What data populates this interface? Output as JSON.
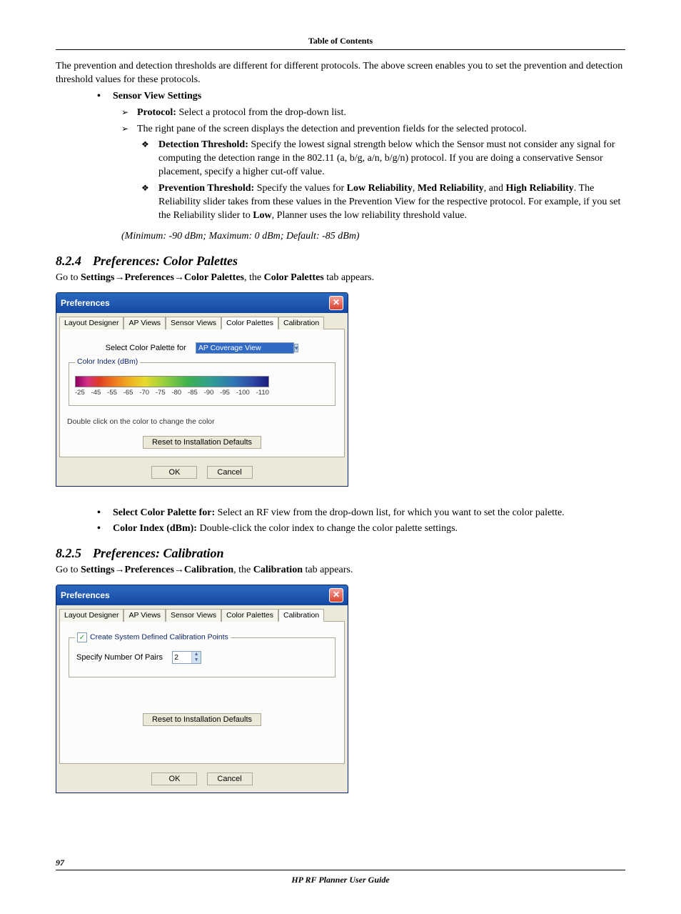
{
  "header": {
    "toc": "Table of Contents"
  },
  "intro": "The prevention and detection thresholds are different for different protocols. The above screen enables you to set the prevention and detection threshold values for these protocols.",
  "sensor_view": {
    "title": "Sensor View Settings",
    "protocol": {
      "label": "Protocol:",
      "text": " Select a protocol from the drop‑down list."
    },
    "right_pane": "The right pane of the screen displays the detection and prevention fields for the selected protocol.",
    "detection": {
      "label": "Detection Threshold:",
      "text": " Specify the lowest signal strength below which the Sensor must not consider any signal for computing the detection range in the 802.11 (a, b/g, a/n, b/g/n) protocol. If you are doing a conservative Sensor placement, specify a higher cut‑off value."
    },
    "prevention": {
      "label": "Prevention Threshold:",
      "pre": " Specify the values for ",
      "low": "Low Reliability",
      "mid": ", ",
      "med": "Med Reliability",
      "mid2": ", and ",
      "high": "High Reliability",
      "post": ". The Reliability slider takes from these values in the Prevention View for the respective protocol. For example, if you set the Reliability slider to ",
      "low2": "Low",
      "post2": ", Planner uses the low reliability threshold value."
    },
    "minmax": "(Minimum: -90 dBm; Maximum: 0 dBm; Default: -85 dBm)"
  },
  "sec824": {
    "num": "8.2.4",
    "title": "Preferences: Color Palettes",
    "goto_pre": "Go to ",
    "path1": "Settings",
    "arrow": "→",
    "path2": "Preferences",
    "path3": "Color Palettes",
    "mid": ", the ",
    "tab": "Color Palettes",
    "post": " tab appears."
  },
  "dlg1": {
    "title": "Preferences",
    "tabs": [
      "Layout Designer",
      "AP Views",
      "Sensor Views",
      "Color Palettes",
      "Calibration"
    ],
    "active_tab": 3,
    "select_label": "Select Color Palette for",
    "select_value": "AP Coverage View",
    "group_title": "Color Index (dBm)",
    "scale": [
      "-25",
      "-45",
      "-55",
      "-65",
      "-70",
      "-75",
      "-80",
      "-85",
      "-90",
      "-95",
      "-100",
      "-110"
    ],
    "hint": "Double click on the color to change the color",
    "reset": "Reset to Installation Defaults",
    "ok": "OK",
    "cancel": "Cancel"
  },
  "post824": {
    "b1": {
      "label": "Select Color Palette for:",
      "text": " Select an RF view from the drop‑down list, for which you want to set the color palette."
    },
    "b2": {
      "label": "Color Index (dBm):",
      "text": " Double‑click the color index to change the color palette settings."
    }
  },
  "sec825": {
    "num": "8.2.5",
    "title": "Preferences: Calibration",
    "goto_pre": "Go to ",
    "path1": "Settings",
    "arrow": "→",
    "path2": "Preferences",
    "path3": "Calibration",
    "mid": ", the ",
    "tab": "Calibration",
    "post": " tab appears."
  },
  "dlg2": {
    "title": "Preferences",
    "tabs": [
      "Layout Designer",
      "AP Views",
      "Sensor Views",
      "Color Palettes",
      "Calibration"
    ],
    "active_tab": 4,
    "chk_label": "Create System Defined Calibration Points",
    "pairs_label": "Specify Number Of Pairs",
    "pairs_value": "2",
    "reset": "Reset to Installation Defaults",
    "ok": "OK",
    "cancel": "Cancel"
  },
  "footer": {
    "page": "97",
    "guide": "HP RF Planner User Guide"
  }
}
